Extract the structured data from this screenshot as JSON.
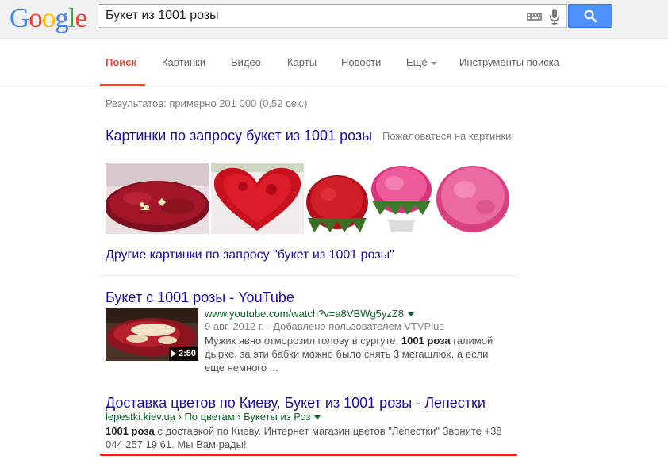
{
  "header": {
    "logo": "Google",
    "query": "Букет из 1001 розы"
  },
  "tabs": [
    {
      "label": "Поиск",
      "active": true
    },
    {
      "label": "Картинки"
    },
    {
      "label": "Видео"
    },
    {
      "label": "Карты"
    },
    {
      "label": "Новости"
    },
    {
      "label": "Ещё"
    },
    {
      "label": "Инструменты поиска"
    }
  ],
  "stats": "Результатов: примерно 201 000 (0,52 сек.)",
  "images": {
    "heading": "Картинки по запросу букет из 1001 розы",
    "report": "Пожаловаться на картинки",
    "more": "Другие картинки по запросу \"букет из 1001 розы\""
  },
  "results": [
    {
      "title": "Букет с 1001 розы - YouTube",
      "url": "www.youtube.com/watch?v=a8VBWg5yzZ8",
      "meta": "9 авг. 2012 г. - Добавлено пользователем VTVPlus",
      "snippet_lines": [
        [
          "Мужик явно отморозил голову в сургуте, ",
          "1001 роза",
          " галимой"
        ],
        [
          "дырке, за эти бабки можно было снять 3 мегашлюх, а если"
        ],
        [
          "еще немного ..."
        ]
      ],
      "duration": "2:50"
    },
    {
      "title": "Доставка цветов по Киеву, Букет из 1001 розы - Лепестки",
      "url": "lepestki.kiev.ua › По цветам › Букеты из Роз",
      "snippet_lines": [
        [
          "",
          "1001 роза",
          " с доставкой по Киеву. Интернет магазин цветов \"Лепестки\" Звоните +38"
        ],
        [
          "044 257 19 61. Мы Вам рады!"
        ]
      ]
    }
  ]
}
